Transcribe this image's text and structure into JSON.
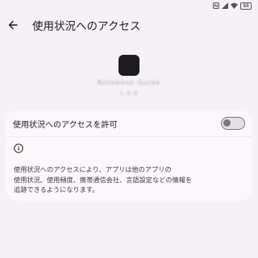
{
  "status_bar": {
    "battery": "88"
  },
  "header": {
    "title": "使用状況へのアクセス"
  },
  "app": {
    "name": "Notebook Guide",
    "version": "1.0.0"
  },
  "permission": {
    "label": "使用状況へのアクセスを許可",
    "enabled": false
  },
  "info": {
    "text": "使用状況へのアクセスにより、アプリは他のアプリの\n使用状況、使用頻度、携帯通信会社、言語設定などの情報を\n追跡できるようになります。"
  },
  "colors": {
    "background": "#f6f1f7",
    "card": "#fcf7fb",
    "app_icon": "#1c1b1f"
  }
}
